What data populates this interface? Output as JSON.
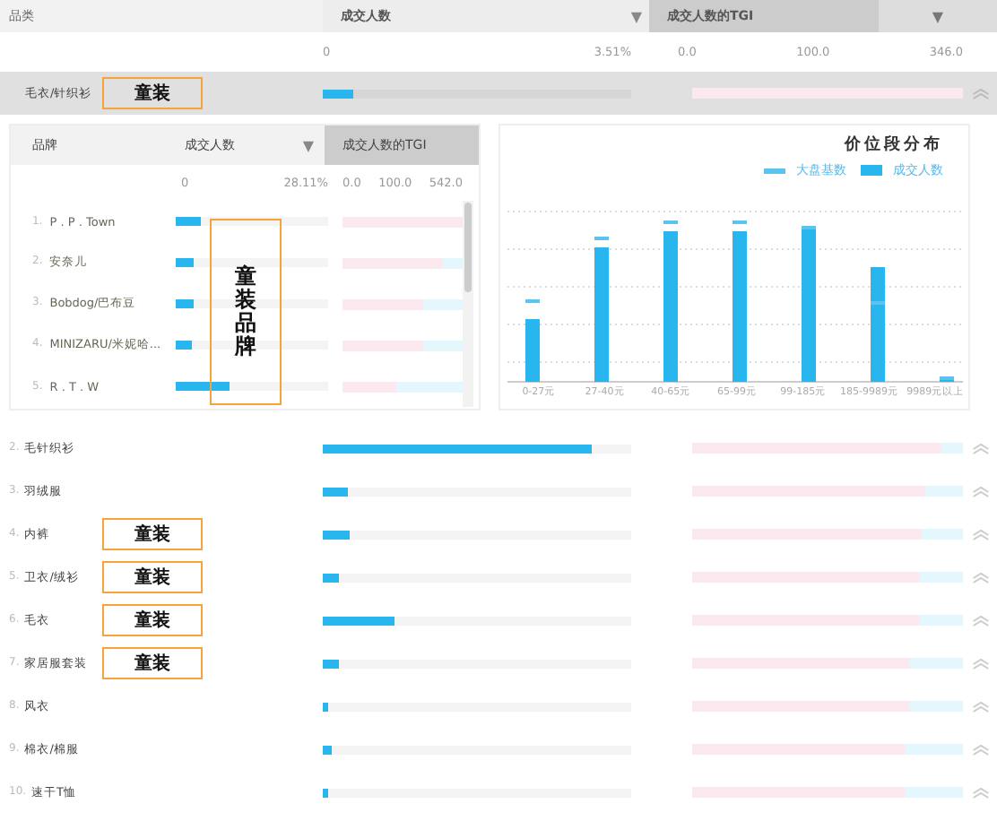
{
  "header": {
    "category_label": "品类",
    "count_label": "成交人数",
    "count_sort": "▼",
    "tgi_label": "成交人数的TGI",
    "tgi_sort": "▼"
  },
  "scale": {
    "count_min": "0",
    "count_max": "3.51%",
    "tgi_min": "0.0",
    "tgi_mid": "100.0",
    "tgi_max": "346.0"
  },
  "selected_row": {
    "name": "毛衣/针织衫",
    "note": "童装",
    "count": {
      "level": 0.1
    },
    "tgi": {
      "level": 1.0
    }
  },
  "brand_panel": {
    "header": {
      "brand_label": "品牌",
      "count_label": "成交人数",
      "count_sort": "▼",
      "tgi_label": "成交人数的TGI"
    },
    "scale": {
      "count_min": "0",
      "count_max": "28.11%",
      "tgi_min": "0.0",
      "tgi_mid": "100.0",
      "tgi_max": "542.0"
    },
    "note": "童装品牌",
    "rows": [
      {
        "rank": "1.",
        "name": "P . P . Town",
        "count": {
          "level": 0.17
        },
        "tgi": {
          "level": 1.0
        }
      },
      {
        "rank": "2.",
        "name": "安奈儿",
        "count": {
          "level": 0.12
        },
        "tgi": {
          "level": 0.84
        }
      },
      {
        "rank": "3.",
        "name": "Bobdog/巴布豆",
        "count": {
          "level": 0.12
        },
        "tgi": {
          "level": 0.67
        }
      },
      {
        "rank": "4.",
        "name": "MINIZARU/米妮哈...",
        "count": {
          "level": 0.1
        },
        "tgi": {
          "level": 0.67
        }
      },
      {
        "rank": "5.",
        "name": "R . T . W",
        "count": {
          "level": 0.35
        },
        "tgi": {
          "level": 0.45
        }
      }
    ]
  },
  "price_chart": {
    "title": "价位段分布",
    "legend": [
      {
        "kind": "marker",
        "label": "大盘基数"
      },
      {
        "kind": "bar",
        "label": "成交人数"
      }
    ],
    "categories": [
      "0-27元",
      "27-40元",
      "40-65元",
      "65-99元",
      "99-185元",
      "185-9989元",
      "9989元以上"
    ]
  },
  "rows": [
    {
      "rank": "2.",
      "name": "毛针织衫",
      "count": {
        "level": 0.87
      },
      "tgi": {
        "level": 0.92
      }
    },
    {
      "rank": "3.",
      "name": "羽绒服",
      "count": {
        "level": 0.08
      },
      "tgi": {
        "level": 0.86
      }
    },
    {
      "rank": "4.",
      "name": "内裤",
      "note": "童装",
      "count": {
        "level": 0.09
      },
      "tgi": {
        "level": 0.85
      }
    },
    {
      "rank": "5.",
      "name": "卫衣/绒衫",
      "note": "童装",
      "count": {
        "level": 0.05
      },
      "tgi": {
        "level": 0.84
      }
    },
    {
      "rank": "6.",
      "name": "毛衣",
      "note": "童装",
      "count": {
        "level": 0.23
      },
      "tgi": {
        "level": 0.84
      }
    },
    {
      "rank": "7.",
      "name": "家居服套装",
      "note": "童装",
      "count": {
        "level": 0.05
      },
      "tgi": {
        "level": 0.8
      }
    },
    {
      "rank": "8.",
      "name": "风衣",
      "count": {
        "level": 0.02
      },
      "tgi": {
        "level": 0.8
      }
    },
    {
      "rank": "9.",
      "name": "棉衣/棉服",
      "count": {
        "level": 0.03
      },
      "tgi": {
        "level": 0.79
      }
    },
    {
      "rank": "10.",
      "name": "速干T恤",
      "count": {
        "level": 0.02
      },
      "tgi": {
        "level": 0.79
      }
    }
  ]
}
